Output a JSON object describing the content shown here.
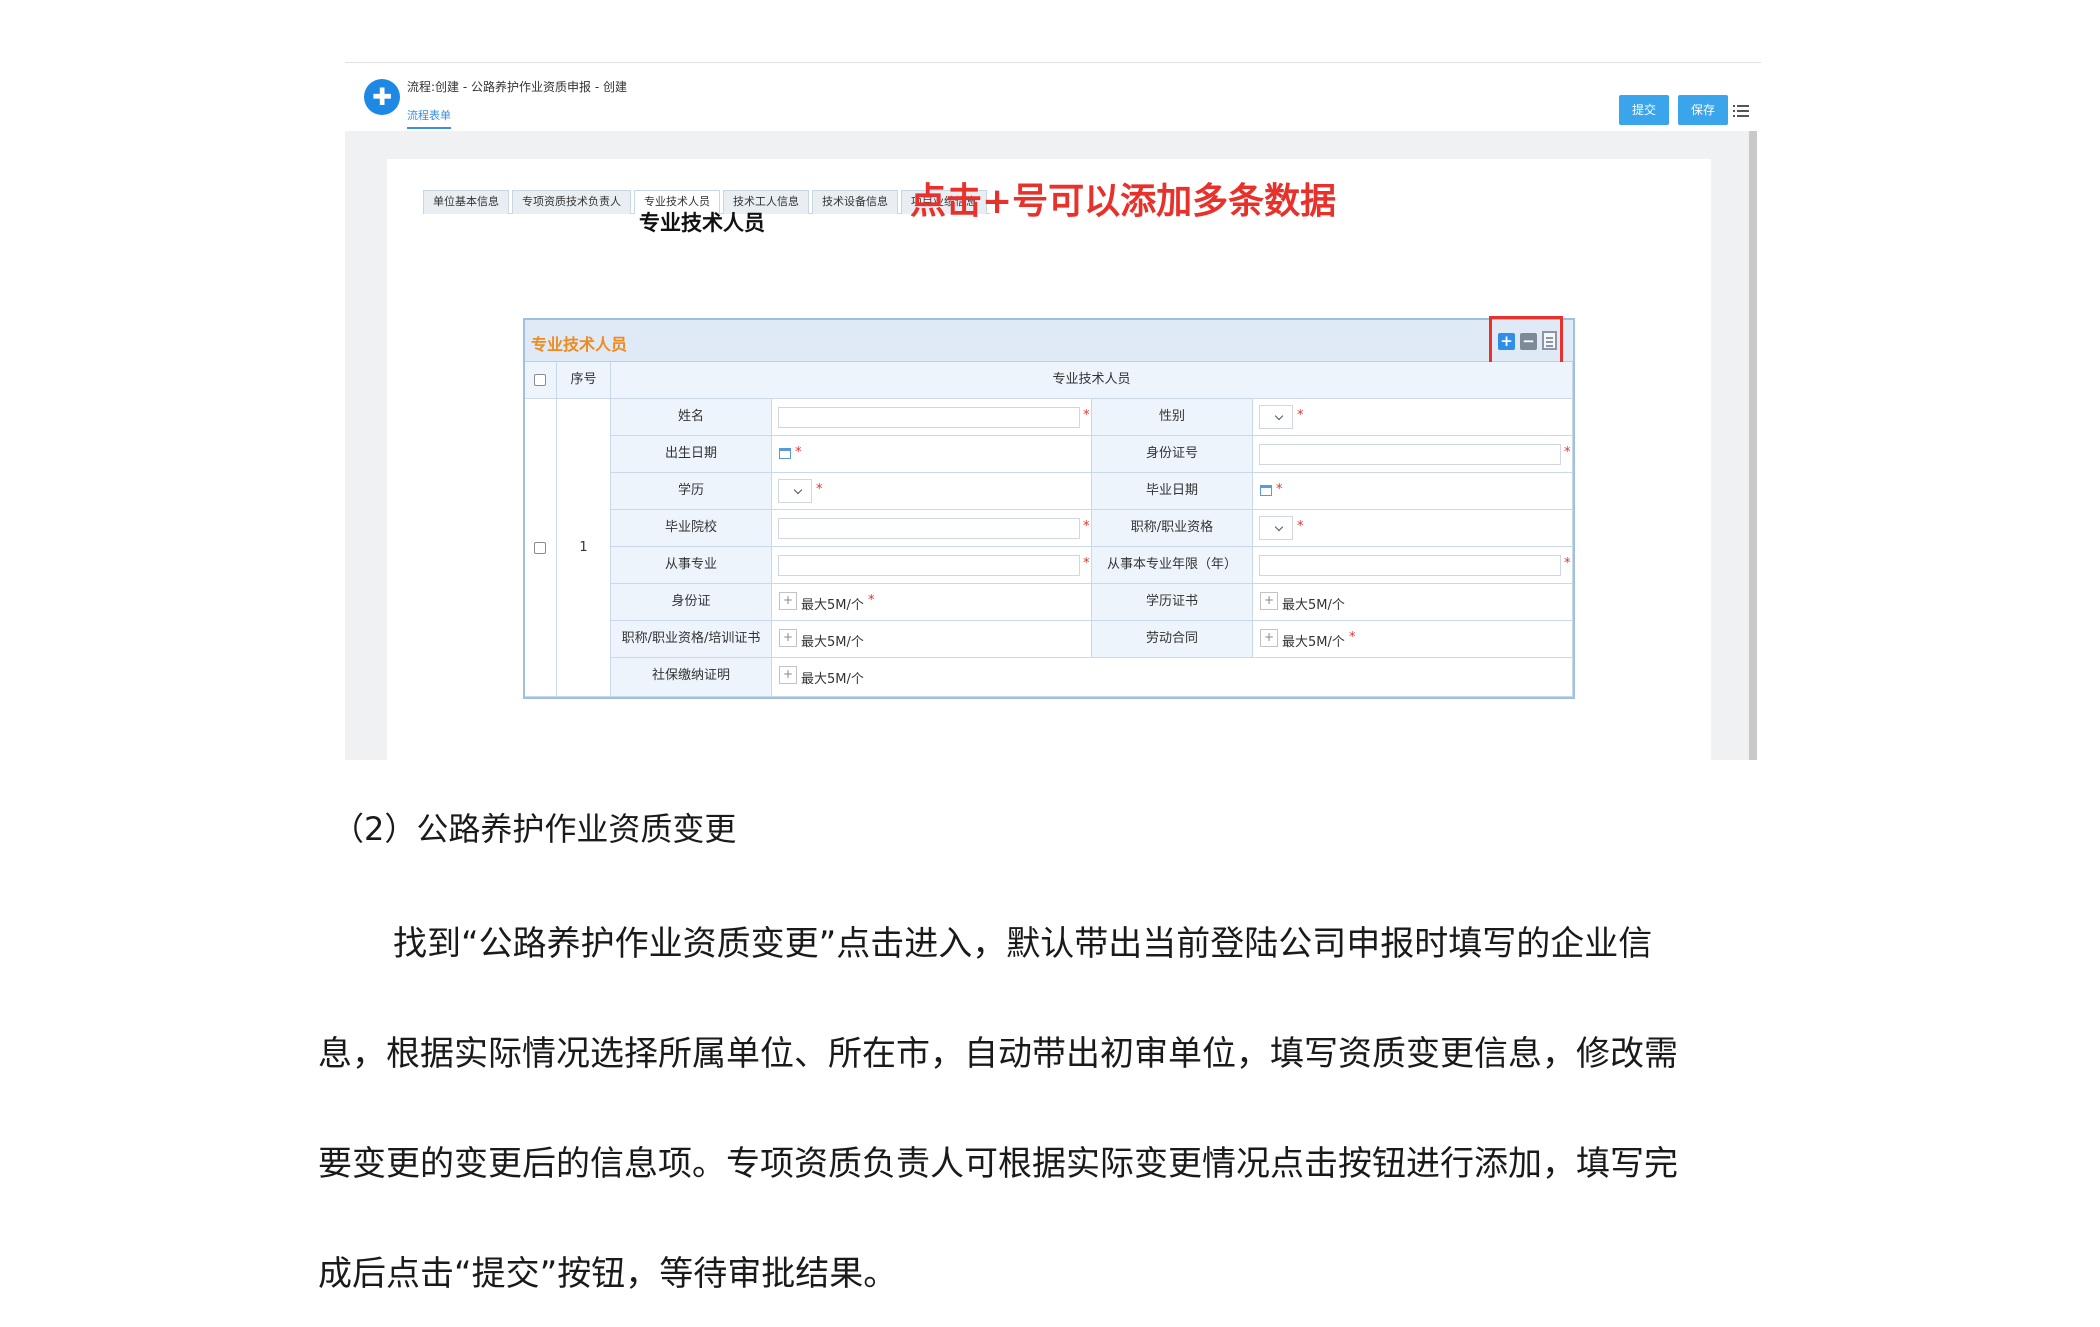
{
  "app": {
    "logo_glyph": "✚",
    "title": "流程:创建 - 公路养护作业资质申报 - 创建",
    "subtab": "流程表单",
    "submit_label": "提交",
    "save_label": "保存"
  },
  "tabs": [
    "单位基本信息",
    "专项资质技术负责人",
    "专业技术人员",
    "技术工人信息",
    "技术设备信息",
    "项目业绩信息"
  ],
  "active_tab": "专业技术人员",
  "form_title": "专业技术人员",
  "annotation": "点击+号可以添加多条数据",
  "grid": {
    "title": "专业技术人员",
    "add_glyph": "+",
    "remove_glyph": "−",
    "col_seq": "序号",
    "col_main": "专业技术人员",
    "row_seq": "1",
    "fields": {
      "name": "姓名",
      "gender": "性别",
      "birth": "出生日期",
      "id_no": "身份证号",
      "education": "学历",
      "grad_date": "毕业日期",
      "school": "毕业院校",
      "title_qual": "职称/职业资格",
      "major": "从事专业",
      "years": "从事本专业年限（年）",
      "id_card": "身份证",
      "edu_cert": "学历证书",
      "cert_train": "职称/职业资格/培训证书",
      "contract": "劳动合同",
      "social": "社保缴纳证明"
    },
    "upload_hint": "最大5M/个",
    "required_mark": "*",
    "upload_glyph": "+"
  },
  "doc": {
    "heading": "（2）公路养护作业资质变更",
    "lines": [
      "找到“公路养护作业资质变更”点击进入，默认带出当前登陆公司申报时填写的企业信",
      "息，根据实际情况选择所属单位、所在市，自动带出初审单位，填写资质变更信息，修改需",
      "要变更的变更后的信息项。专项资质负责人可根据实际变更情况点击按钮进行添加，填写完",
      "成后点击“提交”按钮，等待审批结果。"
    ]
  },
  "colors": {
    "accent": "#3aa5ea",
    "annotation": "#e8312b",
    "grid_title": "#f08a1c"
  }
}
